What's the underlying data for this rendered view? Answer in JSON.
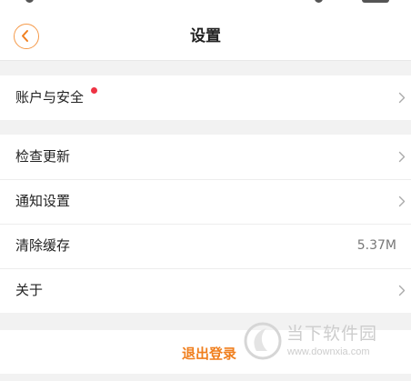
{
  "nav": {
    "back_icon": "chevron-left-icon",
    "title": "设置"
  },
  "account_group": {
    "items": [
      {
        "label": "账户与安全",
        "has_badge": true,
        "badge_color": "#ee3344"
      }
    ]
  },
  "settings_group": {
    "items": [
      {
        "label": "检查更新"
      },
      {
        "label": "通知设置"
      },
      {
        "label": "清除缓存",
        "value": "5.37M"
      },
      {
        "label": "关于"
      }
    ]
  },
  "logout": {
    "label": "退出登录"
  },
  "watermark": {
    "text_cn": "当下软件园",
    "url": "www.downxia.com"
  },
  "colors": {
    "accent": "#f07f1e",
    "badge": "#ee3344",
    "background": "#f2f2f2"
  }
}
